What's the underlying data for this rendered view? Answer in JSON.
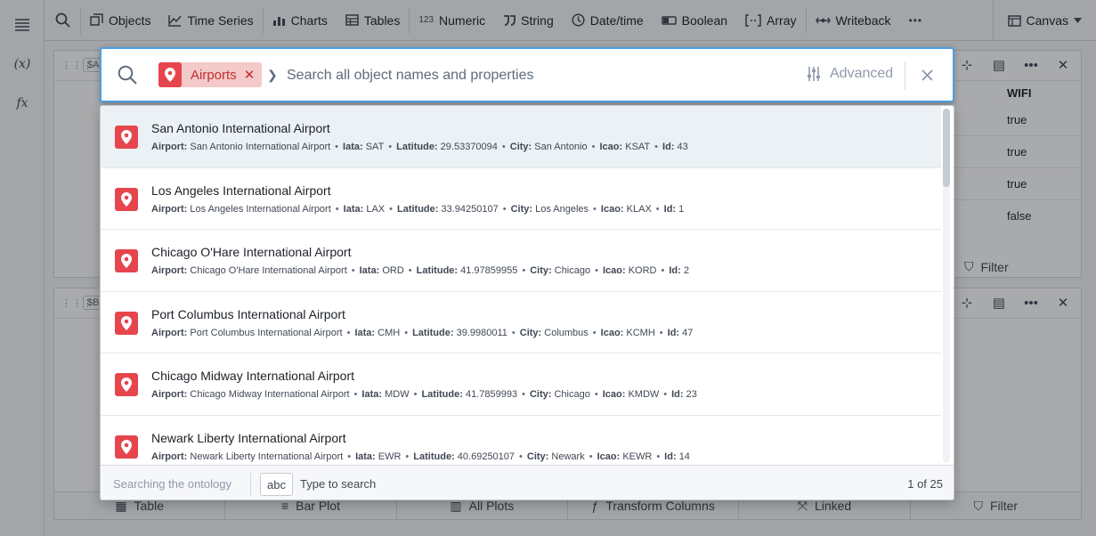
{
  "toolbar": {
    "items": [
      {
        "label": "Objects",
        "icon": "cube-icon"
      },
      {
        "label": "Time Series",
        "icon": "timeline-icon"
      },
      {
        "label": "Charts",
        "icon": "chart-icon"
      },
      {
        "label": "Tables",
        "icon": "table-icon"
      },
      {
        "label": "Numeric",
        "icon": "123-icon"
      },
      {
        "label": "String",
        "icon": "quote-icon"
      },
      {
        "label": "Date/time",
        "icon": "clock-icon"
      },
      {
        "label": "Boolean",
        "icon": "toggle-icon"
      },
      {
        "label": "Array",
        "icon": "brackets-icon"
      },
      {
        "label": "Writeback",
        "icon": "writeback-icon"
      }
    ],
    "numeric_glyph": "123",
    "more": "•••",
    "canvas_label": "Canvas"
  },
  "rail": {
    "variable": "(x)",
    "function": "fx"
  },
  "background": {
    "panel1_tag": "$A",
    "panel2_tag": "$B",
    "column_header": "WIFI",
    "cells": [
      "true",
      "true",
      "true",
      "false"
    ],
    "filter_label": "Filter",
    "bottom_tabs": [
      "Table",
      "Bar Plot",
      "All Plots",
      "Transform Columns",
      "Linked"
    ],
    "bottom_filter": "Filter"
  },
  "omnibar": {
    "object_type_chip": "Airports",
    "chip_color": "#e6454d",
    "placeholder": "Search all object names and properties",
    "value": "",
    "advanced_label": "Advanced",
    "results": [
      {
        "title": "San Antonio International Airport",
        "props": [
          {
            "k": "Airport:",
            "v": "San Antonio International Airport"
          },
          {
            "k": "Iata:",
            "v": "SAT"
          },
          {
            "k": "Latitude:",
            "v": "29.53370094"
          },
          {
            "k": "City:",
            "v": "San Antonio"
          },
          {
            "k": "Icao:",
            "v": "KSAT"
          },
          {
            "k": "Id:",
            "v": "43"
          }
        ]
      },
      {
        "title": "Los Angeles International Airport",
        "props": [
          {
            "k": "Airport:",
            "v": "Los Angeles International Airport"
          },
          {
            "k": "Iata:",
            "v": "LAX"
          },
          {
            "k": "Latitude:",
            "v": "33.94250107"
          },
          {
            "k": "City:",
            "v": "Los Angeles"
          },
          {
            "k": "Icao:",
            "v": "KLAX"
          },
          {
            "k": "Id:",
            "v": "1"
          }
        ]
      },
      {
        "title": "Chicago O'Hare International Airport",
        "props": [
          {
            "k": "Airport:",
            "v": "Chicago O'Hare International Airport"
          },
          {
            "k": "Iata:",
            "v": "ORD"
          },
          {
            "k": "Latitude:",
            "v": "41.97859955"
          },
          {
            "k": "City:",
            "v": "Chicago"
          },
          {
            "k": "Icao:",
            "v": "KORD"
          },
          {
            "k": "Id:",
            "v": "2"
          }
        ]
      },
      {
        "title": "Port Columbus International Airport",
        "props": [
          {
            "k": "Airport:",
            "v": "Port Columbus International Airport"
          },
          {
            "k": "Iata:",
            "v": "CMH"
          },
          {
            "k": "Latitude:",
            "v": "39.9980011"
          },
          {
            "k": "City:",
            "v": "Columbus"
          },
          {
            "k": "Icao:",
            "v": "KCMH"
          },
          {
            "k": "Id:",
            "v": "47"
          }
        ]
      },
      {
        "title": "Chicago Midway International Airport",
        "props": [
          {
            "k": "Airport:",
            "v": "Chicago Midway International Airport"
          },
          {
            "k": "Iata:",
            "v": "MDW"
          },
          {
            "k": "Latitude:",
            "v": "41.7859993"
          },
          {
            "k": "City:",
            "v": "Chicago"
          },
          {
            "k": "Icao:",
            "v": "KMDW"
          },
          {
            "k": "Id:",
            "v": "23"
          }
        ]
      },
      {
        "title": "Newark Liberty International Airport",
        "props": [
          {
            "k": "Airport:",
            "v": "Newark Liberty International Airport"
          },
          {
            "k": "Iata:",
            "v": "EWR"
          },
          {
            "k": "Latitude:",
            "v": "40.69250107"
          },
          {
            "k": "City:",
            "v": "Newark"
          },
          {
            "k": "Icao:",
            "v": "KEWR"
          },
          {
            "k": "Id:",
            "v": "14"
          }
        ]
      }
    ],
    "footer": {
      "status": "Searching the ontology",
      "kbd": "abc",
      "hint": "Type to search",
      "count": "1 of 25"
    }
  }
}
